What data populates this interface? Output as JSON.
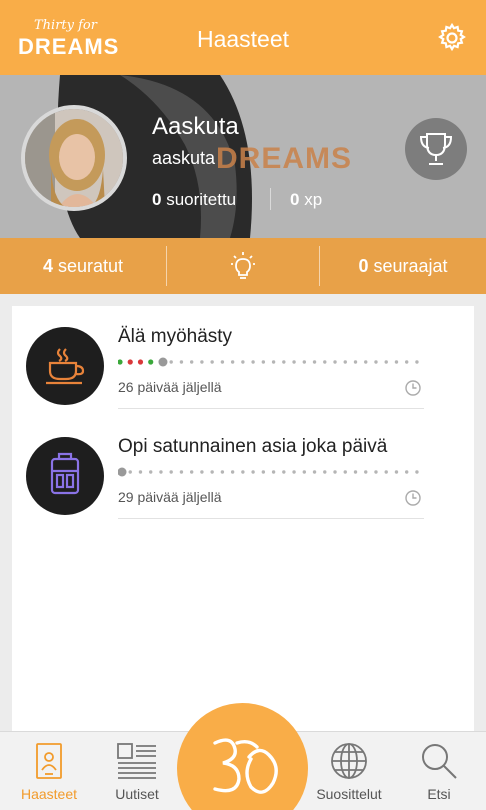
{
  "header": {
    "logo_small": "Thirty for",
    "logo_big": "DREAMS",
    "title": "Haasteet"
  },
  "profile": {
    "name": "Aaskuta",
    "handle": "aaskuta",
    "watermark": "DREAMS",
    "completed_count": "0",
    "completed_label": "suoritettu",
    "xp_count": "0",
    "xp_label": "xp"
  },
  "social": {
    "following_count": "4",
    "following_label": "seuratut",
    "followers_count": "0",
    "followers_label": "seuraajat"
  },
  "challenges": [
    {
      "title": "Älä myöhästy",
      "days_left": "26 päivää jäljellä",
      "icon": "coffee-cup-icon",
      "progress_days": [
        {
          "status": "success",
          "color": "#3aa83a"
        },
        {
          "status": "fail",
          "color": "#d9383a"
        },
        {
          "status": "fail",
          "color": "#d9383a"
        },
        {
          "status": "success",
          "color": "#3aa83a"
        },
        {
          "status": "current",
          "color": "#999999"
        }
      ],
      "total_days": 30
    },
    {
      "title": "Opi satunnainen asia joka päivä",
      "days_left": "29 päivää jäljellä",
      "icon": "backpack-icon",
      "progress_days": [
        {
          "status": "current",
          "color": "#999999"
        }
      ],
      "total_days": 30
    }
  ],
  "nav": {
    "items": [
      {
        "label": "Haasteet",
        "icon": "profile-card-icon",
        "active": true
      },
      {
        "label": "Uutiset",
        "icon": "news-icon",
        "active": false
      },
      {
        "label": "Suosittelut",
        "icon": "globe-icon",
        "active": false
      },
      {
        "label": "Etsi",
        "icon": "search-icon",
        "active": false
      }
    ],
    "center_icon": "thirty-logo-icon"
  },
  "colors": {
    "accent": "#f9ad48",
    "social_bar": "#e8a148",
    "coffee_icon": "#e8833a",
    "backpack_icon": "#8a73e6",
    "nav_active": "#f29b2b"
  }
}
